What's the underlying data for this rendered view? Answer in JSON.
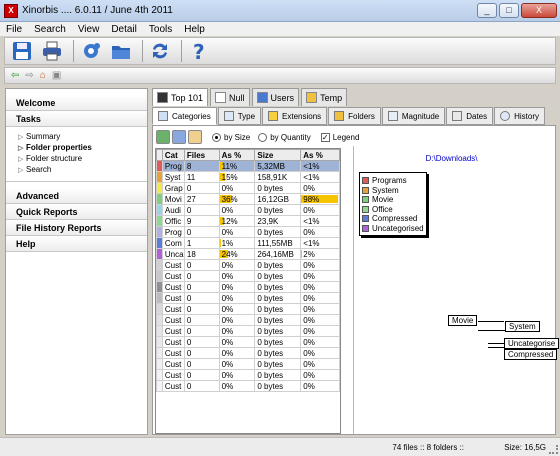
{
  "window": {
    "title": "Xinorbis .... 6.0.11 / June 4th 2011",
    "controls": [
      "_",
      "□",
      "X"
    ]
  },
  "menu": [
    "File",
    "Search",
    "View",
    "Detail",
    "Tools",
    "Help"
  ],
  "toolbar": {
    "buttons": [
      "save-icon",
      "print-icon",
      "settings-icon",
      "open-folder-icon",
      "refresh-icon",
      "help-icon"
    ],
    "nav": [
      "back-icon",
      "forward-icon",
      "home-icon",
      "lock-icon"
    ]
  },
  "sidebar": {
    "welcome": "Welcome",
    "tasks": "Tasks",
    "task_items": [
      {
        "label": "Summary",
        "bold": false
      },
      {
        "label": "Folder properties",
        "bold": true
      },
      {
        "label": "Folder structure",
        "bold": false
      },
      {
        "label": "Search",
        "bold": false
      }
    ],
    "advanced": "Advanced",
    "quick_reports": "Quick Reports",
    "file_history_reports": "File History Reports",
    "help": "Help"
  },
  "top_tabs": [
    {
      "label": "Top 101",
      "icon": "top101-icon",
      "active": true
    },
    {
      "label": "Null",
      "icon": "document-icon",
      "active": false
    },
    {
      "label": "Users",
      "icon": "users-icon",
      "active": false
    },
    {
      "label": "Temp",
      "icon": "temp-folder-icon",
      "active": false
    }
  ],
  "sub_tabs": [
    {
      "label": "Categories",
      "icon": "categories-icon",
      "active": true
    },
    {
      "label": "Type",
      "icon": "type-icon",
      "active": false
    },
    {
      "label": "Extensions",
      "icon": "extensions-icon",
      "active": false
    },
    {
      "label": "Folders",
      "icon": "folders-icon",
      "active": false
    },
    {
      "label": "Magnitude",
      "icon": "magnitude-icon",
      "active": false
    },
    {
      "label": "Dates",
      "icon": "dates-icon",
      "active": false
    },
    {
      "label": "History",
      "icon": "history-icon",
      "active": false
    }
  ],
  "options": {
    "by_size": "by Size",
    "by_quantity": "by Quantity",
    "legend": "Legend",
    "by_size_selected": true,
    "legend_checked": true
  },
  "table": {
    "headers": [
      "Cat",
      "Files",
      "As %",
      "Size",
      "As %"
    ],
    "rows": [
      {
        "color": "#e35a5a",
        "cat": "Prog",
        "files": "8",
        "pct1": "11%",
        "pct1_val": 11,
        "size": "5,32MB",
        "pct2": "<1%",
        "pct2_val": 0,
        "selected": true
      },
      {
        "color": "#e8a23a",
        "cat": "Syst",
        "files": "11",
        "pct1": "15%",
        "pct1_val": 15,
        "size": "158,91K",
        "pct2": "<1%",
        "pct2_val": 0,
        "selected": false
      },
      {
        "color": "#f2ea4a",
        "cat": "Grap",
        "files": "0",
        "pct1": "0%",
        "pct1_val": 0,
        "size": "0 bytes",
        "pct2": "0%",
        "pct2_val": 0,
        "selected": false
      },
      {
        "color": "#7ed07e",
        "cat": "Movi",
        "files": "27",
        "pct1": "36%",
        "pct1_val": 36,
        "size": "16,12GB",
        "pct2": "98%",
        "pct2_val": 98,
        "selected": false
      },
      {
        "color": "#9bd4ea",
        "cat": "Audi",
        "files": "0",
        "pct1": "0%",
        "pct1_val": 0,
        "size": "0 bytes",
        "pct2": "0%",
        "pct2_val": 0,
        "selected": false
      },
      {
        "color": "#8fd88f",
        "cat": "Offic",
        "files": "9",
        "pct1": "12%",
        "pct1_val": 12,
        "size": "23,9K",
        "pct2": "<1%",
        "pct2_val": 0,
        "selected": false
      },
      {
        "color": "#b0b0e8",
        "cat": "Prog",
        "files": "0",
        "pct1": "0%",
        "pct1_val": 0,
        "size": "0 bytes",
        "pct2": "0%",
        "pct2_val": 0,
        "selected": false
      },
      {
        "color": "#5a7ed8",
        "cat": "Com",
        "files": "1",
        "pct1": "1%",
        "pct1_val": 1,
        "size": "111,55MB",
        "pct2": "<1%",
        "pct2_val": 0,
        "selected": false
      },
      {
        "color": "#b060d8",
        "cat": "Unca",
        "files": "18",
        "pct1": "24%",
        "pct1_val": 24,
        "size": "264,16MB",
        "pct2": "2%",
        "pct2_val": 2,
        "selected": false
      },
      {
        "color": "#d0d0d0",
        "cat": "Cust",
        "files": "0",
        "pct1": "0%",
        "pct1_val": 0,
        "size": "0 bytes",
        "pct2": "0%",
        "pct2_val": 0,
        "selected": false
      },
      {
        "color": "#c8c8c8",
        "cat": "Cust",
        "files": "0",
        "pct1": "0%",
        "pct1_val": 0,
        "size": "0 bytes",
        "pct2": "0%",
        "pct2_val": 0,
        "selected": false
      },
      {
        "color": "#909090",
        "cat": "Cust",
        "files": "0",
        "pct1": "0%",
        "pct1_val": 0,
        "size": "0 bytes",
        "pct2": "0%",
        "pct2_val": 0,
        "selected": false
      },
      {
        "color": "#bcbcbc",
        "cat": "Cust",
        "files": "0",
        "pct1": "0%",
        "pct1_val": 0,
        "size": "0 bytes",
        "pct2": "0%",
        "pct2_val": 0,
        "selected": false
      },
      {
        "color": "#d8d8d8",
        "cat": "Cust",
        "files": "0",
        "pct1": "0%",
        "pct1_val": 0,
        "size": "0 bytes",
        "pct2": "0%",
        "pct2_val": 0,
        "selected": false
      },
      {
        "color": "#e0e0e0",
        "cat": "Cust",
        "files": "0",
        "pct1": "0%",
        "pct1_val": 0,
        "size": "0 bytes",
        "pct2": "0%",
        "pct2_val": 0,
        "selected": false
      },
      {
        "color": "#e4e4e4",
        "cat": "Cust",
        "files": "0",
        "pct1": "0%",
        "pct1_val": 0,
        "size": "0 bytes",
        "pct2": "0%",
        "pct2_val": 0,
        "selected": false
      },
      {
        "color": "#e8e8e8",
        "cat": "Cust",
        "files": "0",
        "pct1": "0%",
        "pct1_val": 0,
        "size": "0 bytes",
        "pct2": "0%",
        "pct2_val": 0,
        "selected": false
      },
      {
        "color": "#ececec",
        "cat": "Cust",
        "files": "0",
        "pct1": "0%",
        "pct1_val": 0,
        "size": "0 bytes",
        "pct2": "0%",
        "pct2_val": 0,
        "selected": false
      },
      {
        "color": "#f0f0f0",
        "cat": "Cust",
        "files": "0",
        "pct1": "0%",
        "pct1_val": 0,
        "size": "0 bytes",
        "pct2": "0%",
        "pct2_val": 0,
        "selected": false
      },
      {
        "color": "#f2f2f2",
        "cat": "Cust",
        "files": "0",
        "pct1": "0%",
        "pct1_val": 0,
        "size": "0 bytes",
        "pct2": "0%",
        "pct2_val": 0,
        "selected": false
      },
      {
        "color": "#f4f4f4",
        "cat": "Cust",
        "files": "0",
        "pct1": "0%",
        "pct1_val": 0,
        "size": "0 bytes",
        "pct2": "0%",
        "pct2_val": 0,
        "selected": false
      }
    ]
  },
  "chart": {
    "path": "D:\\Downloads\\",
    "legend": [
      {
        "label": "Programs",
        "color": "#e35a5a"
      },
      {
        "label": "System",
        "color": "#e8a23a"
      },
      {
        "label": "Movie",
        "color": "#7ed07e"
      },
      {
        "label": "Office",
        "color": "#8fd88f"
      },
      {
        "label": "Compressed",
        "color": "#5a7ed8"
      },
      {
        "label": "Uncategorised",
        "color": "#b060d8"
      }
    ],
    "labels": [
      "Movie",
      "System",
      "Uncategorise",
      "Compressed"
    ]
  },
  "status": {
    "files": "74 files :: 8 folders ::",
    "size": "Size: 16,5G"
  }
}
